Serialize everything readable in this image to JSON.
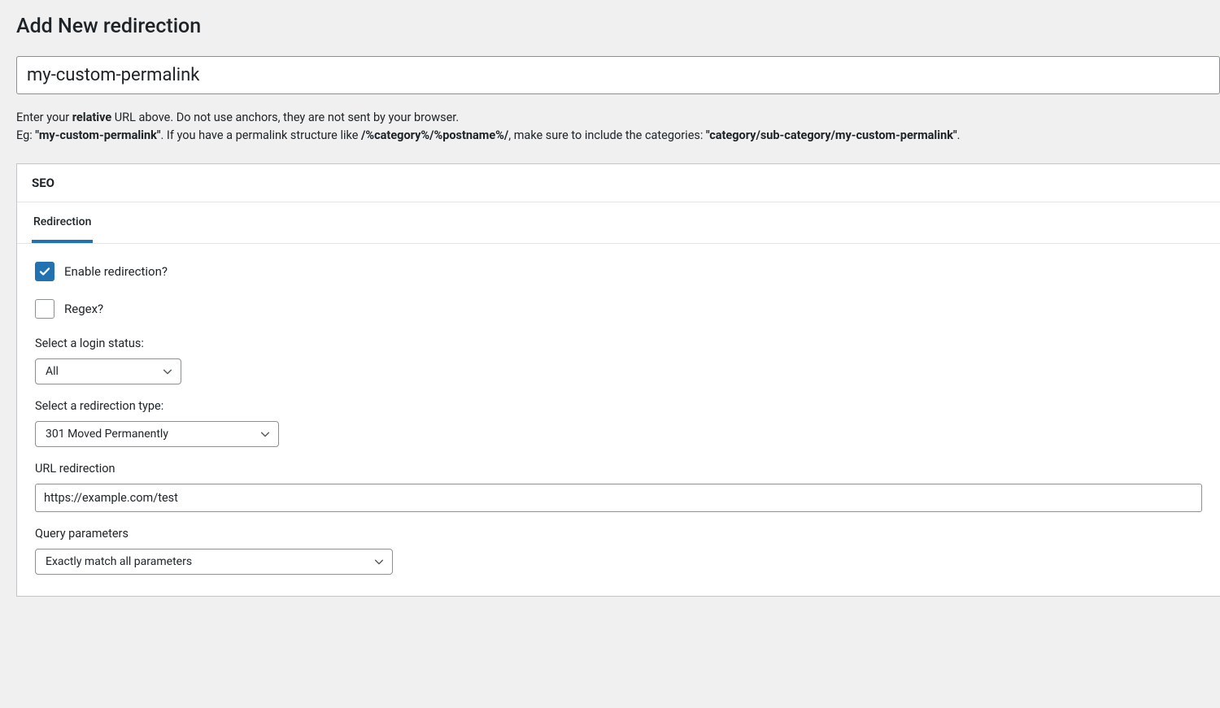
{
  "page": {
    "title": "Add New redirection"
  },
  "mainInput": {
    "value": "my-custom-permalink"
  },
  "hint": {
    "prefix": "Enter your ",
    "relative": "relative",
    "after_relative": " URL above. Do not use anchors, they are not sent by your browser.",
    "line2_prefix": "Eg: ",
    "example1": "\"my-custom-permalink\"",
    "middle1": ". If you have a permalink structure like ",
    "pattern": "/%category%/%postname%/",
    "middle2": ", make sure to include the categories: ",
    "example2": "\"category/sub-category/my-custom-permalink\"",
    "suffix": "."
  },
  "panel": {
    "header": "SEO",
    "tabs": [
      {
        "label": "Redirection"
      }
    ],
    "enable": {
      "label": "Enable redirection?",
      "checked": true
    },
    "regex": {
      "label": "Regex?",
      "checked": false
    },
    "loginStatus": {
      "label": "Select a login status:",
      "value": "All"
    },
    "redirectType": {
      "label": "Select a redirection type:",
      "value": "301 Moved Permanently"
    },
    "urlRedirection": {
      "label": "URL redirection",
      "value": "https://example.com/test"
    },
    "queryParams": {
      "label": "Query parameters",
      "value": "Exactly match all parameters"
    }
  }
}
